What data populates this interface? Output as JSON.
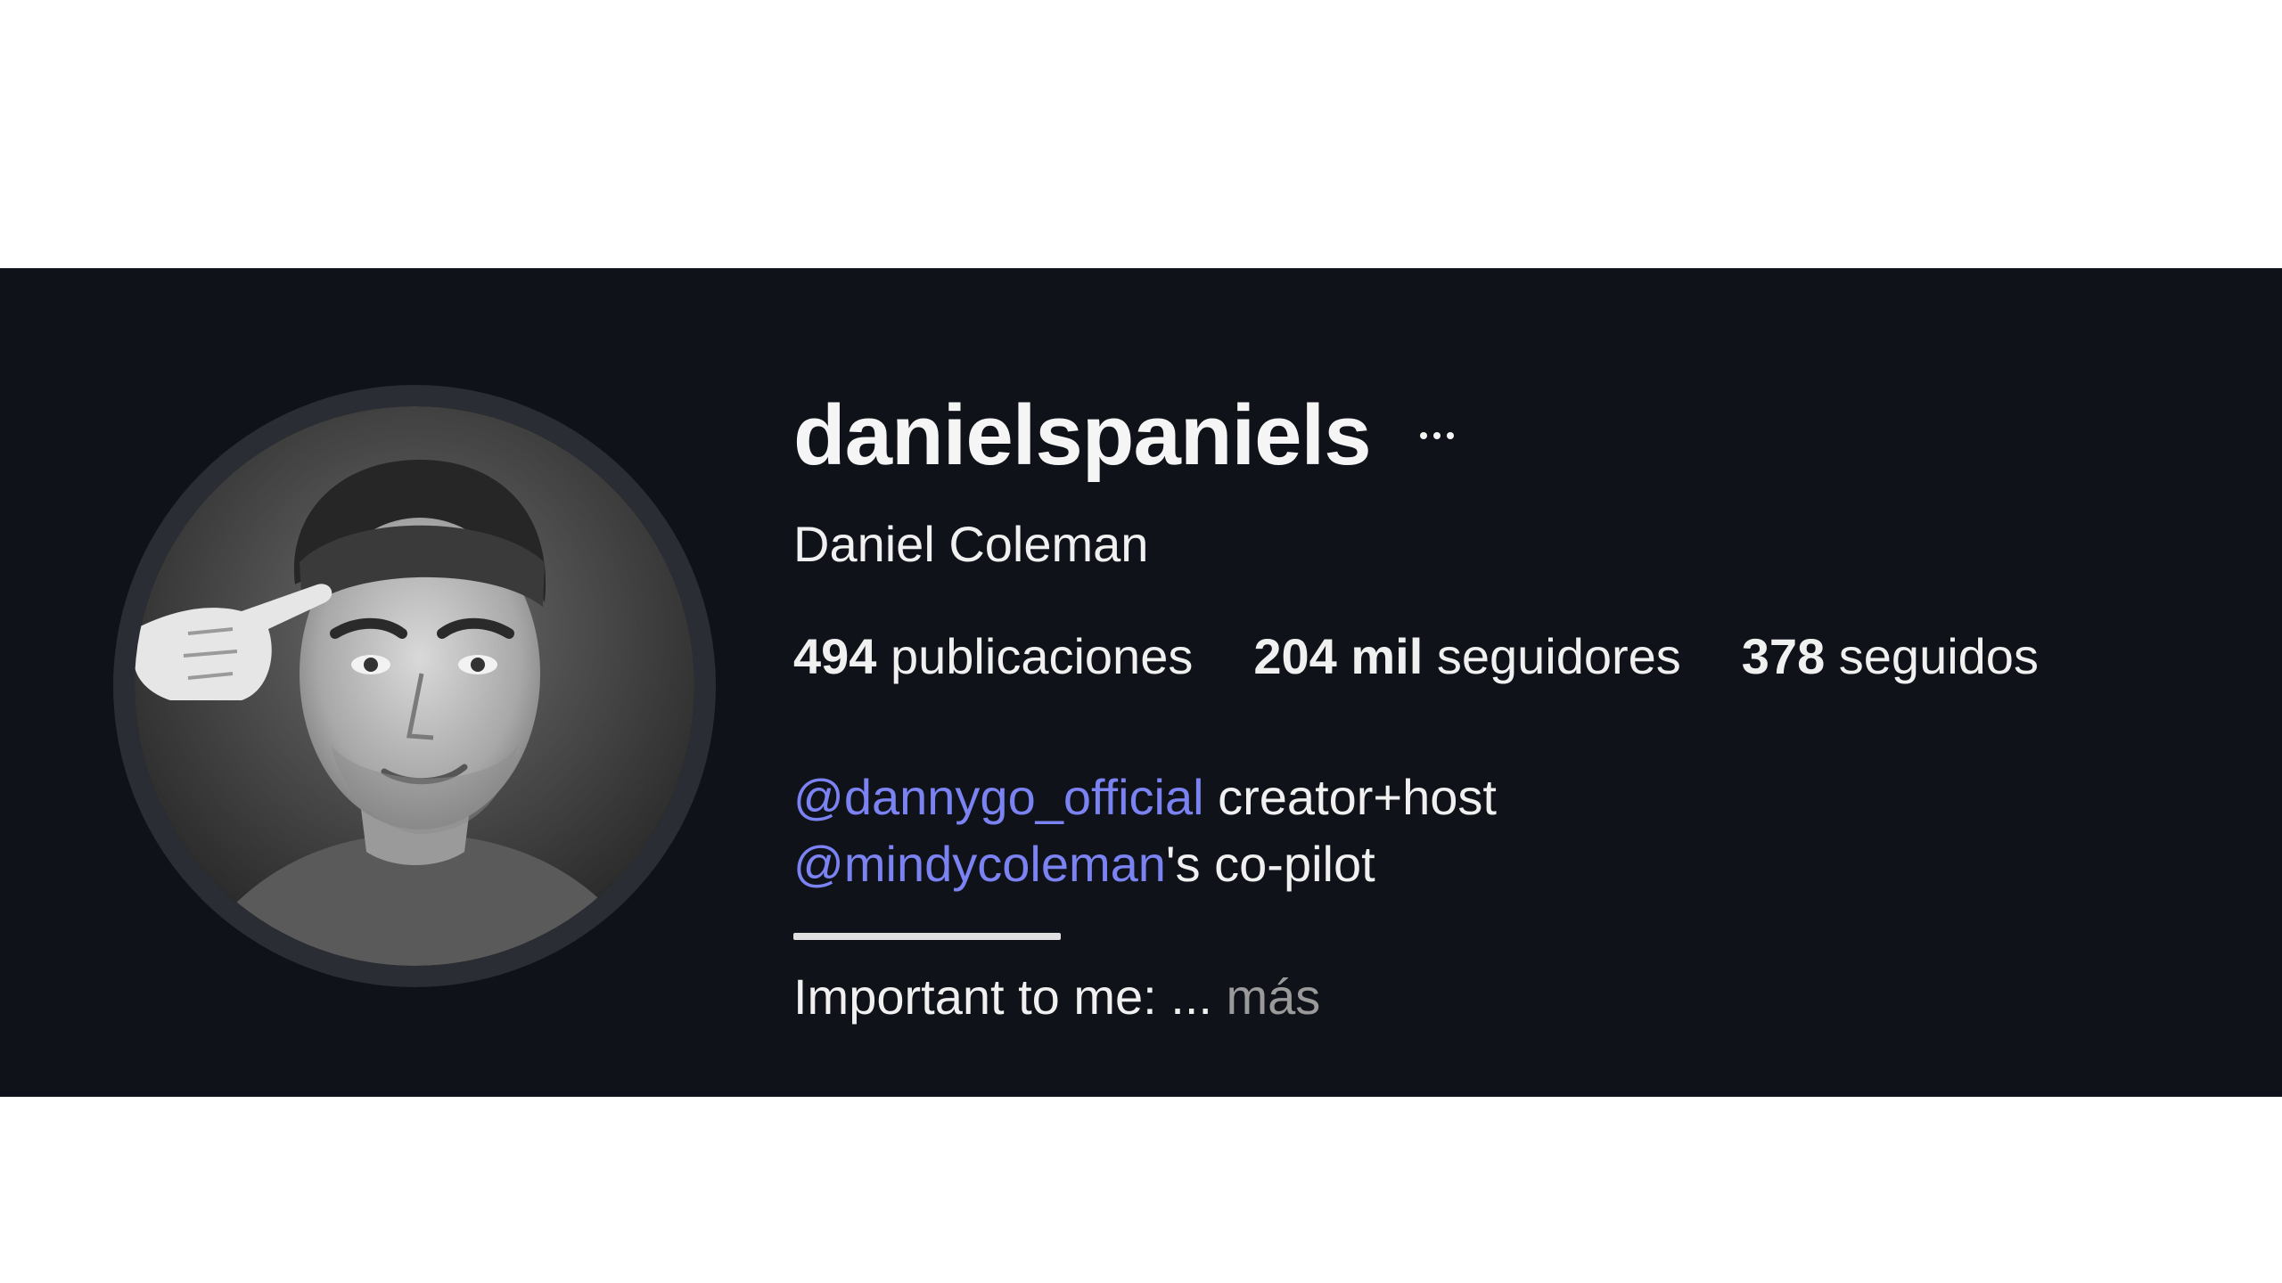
{
  "profile": {
    "username": "danielspaniels",
    "full_name": "Daniel Coleman",
    "stats": {
      "posts_count": "494",
      "posts_label": "publicaciones",
      "followers_count": "204 mil",
      "followers_label": "seguidores",
      "following_count": "378",
      "following_label": "seguidos"
    },
    "bio": {
      "line1_mention": "@dannygo_official",
      "line1_text": " creator+host",
      "line2_mention": "@mindycoleman",
      "line2_text": "'s co-pilot",
      "line3_text": "Important to me: ... ",
      "more_label": "más"
    }
  },
  "icons": {
    "more_options": "ellipsis-icon"
  },
  "colors": {
    "background": "#0f1218",
    "page": "#ffffff",
    "text": "#f0f0f0",
    "mention": "#7b82f2",
    "muted": "#9a9a9a",
    "avatar_ring": "#2a2d33"
  }
}
